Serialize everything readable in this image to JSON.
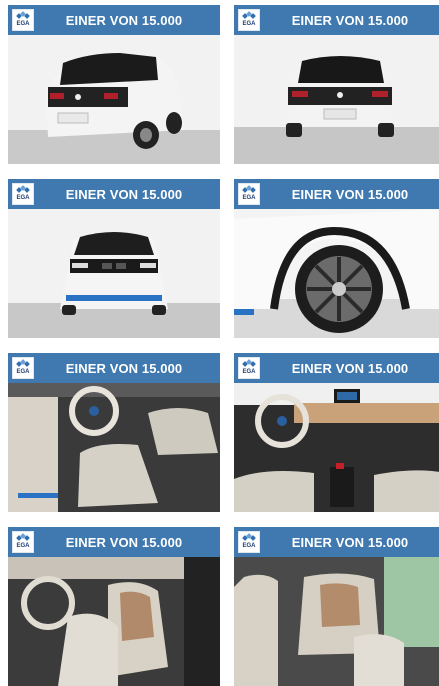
{
  "listing": {
    "badge_text": "EGA",
    "cards": [
      {
        "title": "EINER VON 15.000",
        "image": "bmw-i3-rear-three-quarter"
      },
      {
        "title": "EINER VON 15.000",
        "image": "bmw-i3-rear"
      },
      {
        "title": "EINER VON 15.000",
        "image": "bmw-i3-front"
      },
      {
        "title": "EINER VON 15.000",
        "image": "bmw-i3-wheel"
      },
      {
        "title": "EINER VON 15.000",
        "image": "bmw-i3-interior-driver"
      },
      {
        "title": "EINER VON 15.000",
        "image": "bmw-i3-dashboard"
      },
      {
        "title": "EINER VON 15.000",
        "image": "bmw-i3-front-seats"
      },
      {
        "title": "EINER VON 15.000",
        "image": "bmw-i3-rear-seats"
      }
    ]
  },
  "colors": {
    "banner": "#3f79b0",
    "logo_blue": "#2e6fb0"
  }
}
